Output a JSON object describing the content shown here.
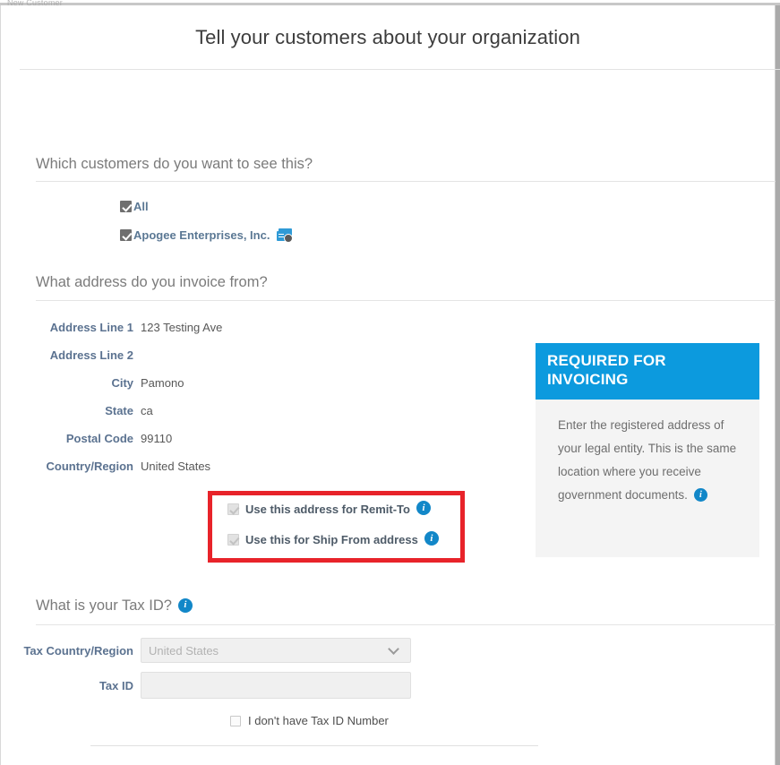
{
  "window": {
    "ghost_text": "New Customer"
  },
  "header": {
    "title": "Tell your customers about your organization"
  },
  "sections": {
    "customers": {
      "heading": "Which customers do you want to see this?",
      "options": [
        {
          "label": "All",
          "checked": true,
          "icon": null
        },
        {
          "label": "Apogee Enterprises, Inc.",
          "checked": true,
          "icon": "customer-card-icon"
        }
      ]
    },
    "address": {
      "heading": "What address do you invoice from?",
      "fields": [
        {
          "label": "Address Line 1",
          "value": "123 Testing Ave"
        },
        {
          "label": "Address Line 2",
          "value": ""
        },
        {
          "label": "City",
          "value": "Pamono"
        },
        {
          "label": "State",
          "value": "ca"
        },
        {
          "label": "Postal Code",
          "value": "99110"
        },
        {
          "label": "Country/Region",
          "value": "United States"
        }
      ],
      "toggles": [
        {
          "label": "Use this address for Remit-To",
          "checked": true,
          "disabled": true,
          "info": "i"
        },
        {
          "label": "Use this for Ship From address",
          "checked": true,
          "disabled": true,
          "info": "i"
        }
      ]
    },
    "callout": {
      "title": "REQUIRED FOR INVOICING",
      "body": "Enter the registered address of your legal entity. This is the same location where you receive government documents.",
      "info": "i",
      "header_color": "#0c9ade",
      "body_bg": "#f4f4f4"
    },
    "tax": {
      "heading": "What is your Tax ID?",
      "heading_info": "i",
      "fields": [
        {
          "label": "Tax Country/Region",
          "value": "United States",
          "type": "select"
        },
        {
          "label": "Tax ID",
          "value": "",
          "type": "text"
        }
      ],
      "no_tax_id": {
        "label": "I don't have Tax ID Number",
        "checked": false
      }
    }
  },
  "highlight": {
    "color": "#e8232a"
  }
}
